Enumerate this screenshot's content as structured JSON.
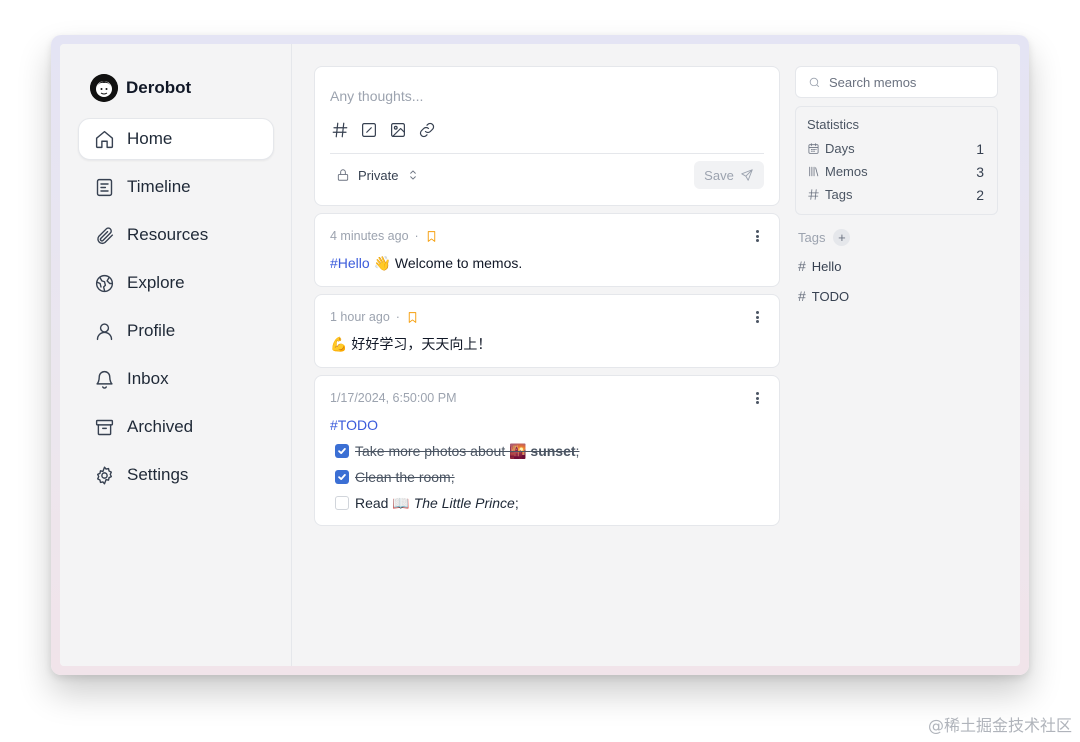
{
  "user": {
    "name": "Derobot"
  },
  "nav": [
    {
      "label": "Home",
      "icon": "home-icon",
      "active": true
    },
    {
      "label": "Timeline",
      "icon": "timeline-icon"
    },
    {
      "label": "Resources",
      "icon": "paperclip-icon"
    },
    {
      "label": "Explore",
      "icon": "globe-icon"
    },
    {
      "label": "Profile",
      "icon": "user-icon"
    },
    {
      "label": "Inbox",
      "icon": "bell-icon"
    },
    {
      "label": "Archived",
      "icon": "archive-icon"
    },
    {
      "label": "Settings",
      "icon": "gear-icon"
    }
  ],
  "editor": {
    "placeholder": "Any thoughts...",
    "visibility": "Private",
    "save_label": "Save"
  },
  "memos": [
    {
      "time": "4 minutes ago",
      "tag": "#Hello",
      "text": "👋 Welcome to memos."
    },
    {
      "time": "1 hour ago",
      "text": "💪 好好学习，天天向上！"
    },
    {
      "time": "1/17/2024, 6:50:00 PM",
      "tag": "#TODO",
      "tasks": [
        {
          "pre": "Take more photos about 🌇 ",
          "bold": "sunset",
          "post": ";",
          "done": true
        },
        {
          "pre": "Clean the room;",
          "done": true
        },
        {
          "pre": "Read 📖 ",
          "italic": "The Little Prince",
          "post": ";",
          "done": false
        }
      ]
    }
  ],
  "search": {
    "placeholder": "Search memos"
  },
  "stats": {
    "title": "Statistics",
    "rows": [
      {
        "label": "Days",
        "value": "1",
        "icon": "calendar-icon"
      },
      {
        "label": "Memos",
        "value": "3",
        "icon": "library-icon"
      },
      {
        "label": "Tags",
        "value": "2",
        "icon": "hash-icon"
      }
    ]
  },
  "tags": {
    "title": "Tags",
    "items": [
      "Hello",
      "TODO"
    ]
  },
  "watermark": "@稀土掘金技术社区",
  "colors": {
    "accent": "#3b6fd4",
    "tag": "#3b5bdb",
    "bookmark": "#f59e0b"
  }
}
